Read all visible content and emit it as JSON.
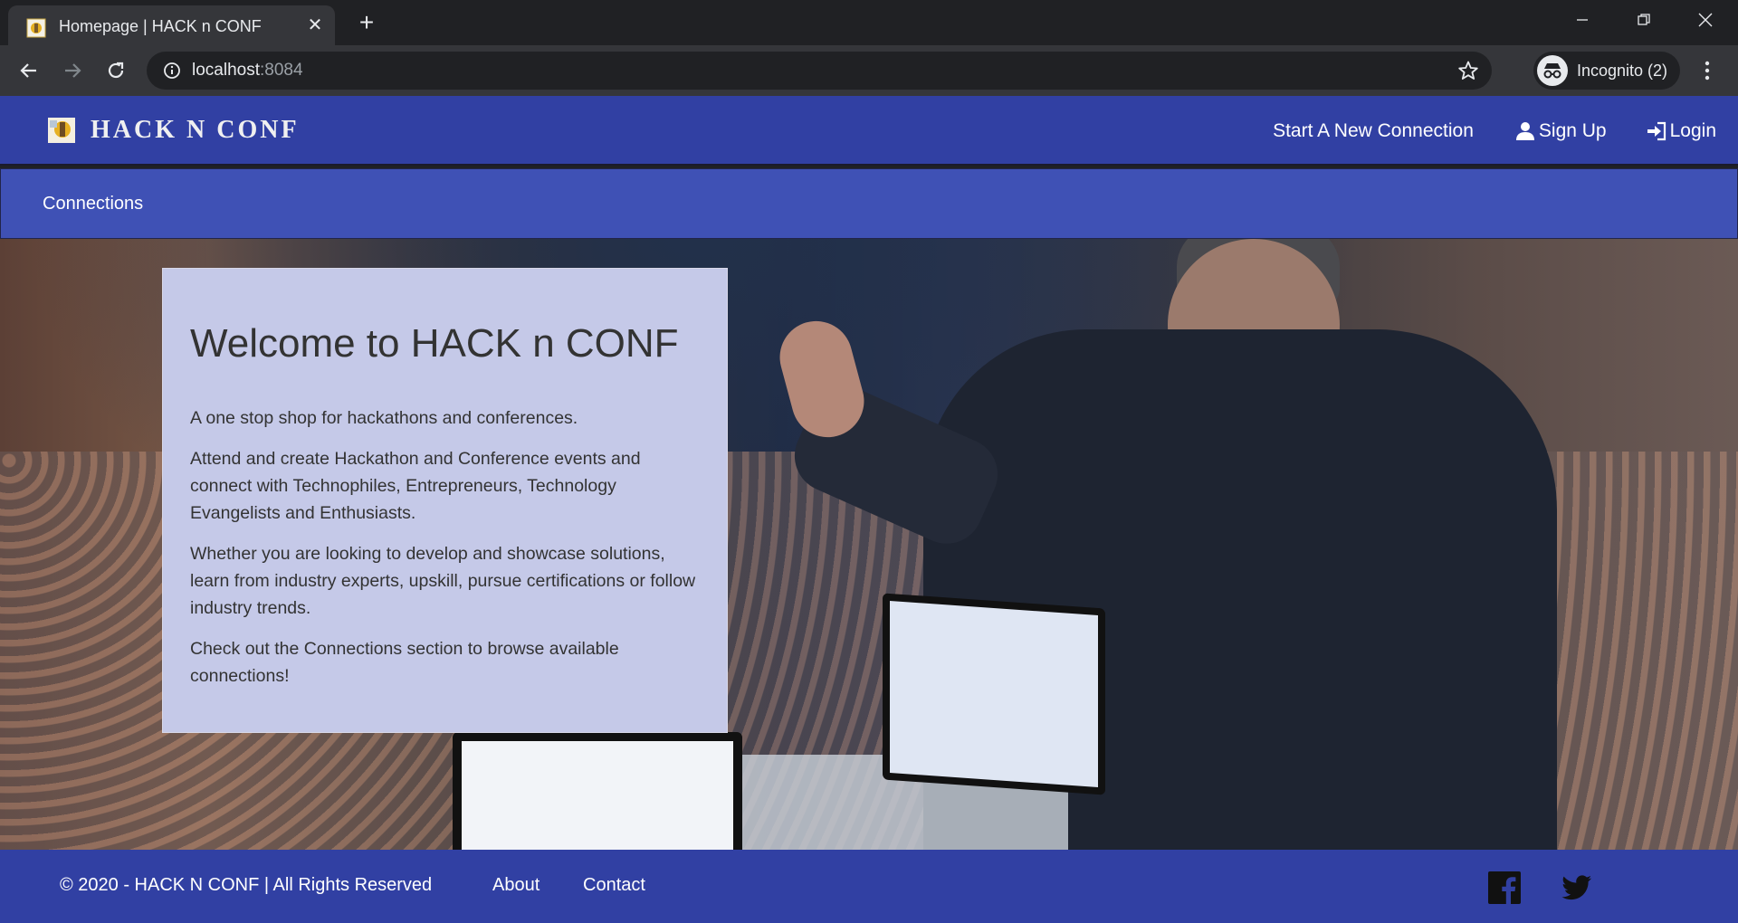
{
  "browser": {
    "tab_title": "Homepage | HACK n CONF",
    "url_host": "localhost",
    "url_port": ":8084",
    "incognito_label": "Incognito (2)"
  },
  "header": {
    "brand": "HACK n CONF",
    "nav": {
      "start_connection": "Start A New Connection",
      "sign_up": "Sign Up",
      "login": "Login"
    }
  },
  "subnav": {
    "connections": "Connections"
  },
  "welcome": {
    "title": "Welcome to HACK n CONF",
    "paragraphs": [
      "A one stop shop for hackathons and conferences.",
      "Attend and create Hackathon and Conference events and connect with Technophiles, Entrepreneurs, Technology Evangelists and Enthusiasts.",
      "Whether you are looking to develop and showcase solutions, learn from industry experts, upskill, pursue certifications or follow industry trends.",
      "Check out the Connections section to browse available connections!"
    ]
  },
  "footer": {
    "copyright": "© 2020 - HACK N CONF | All Rights Reserved",
    "about": "About",
    "contact": "Contact",
    "social": [
      "facebook-icon",
      "twitter-icon"
    ]
  },
  "colors": {
    "header_bg": "#3140a3",
    "subnav_bg": "#3f51b5",
    "welcome_bg": "#c5c9e8"
  }
}
